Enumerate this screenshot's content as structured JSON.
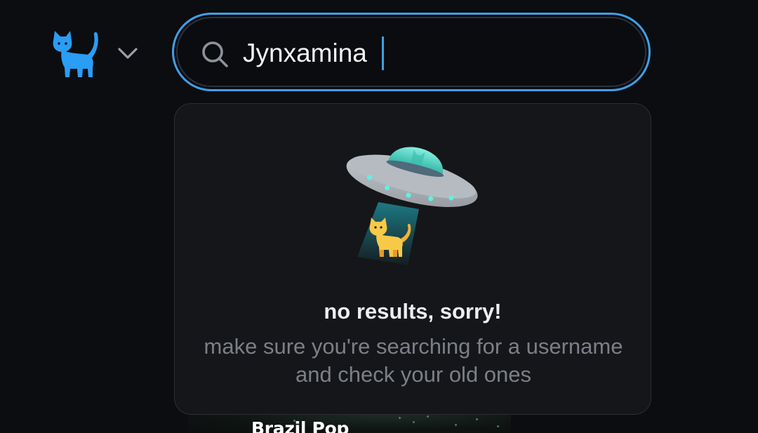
{
  "header": {
    "logo_icon": "cat-icon",
    "account_menu_icon": "chevron-down-icon"
  },
  "search": {
    "icon": "search-icon",
    "value": "Jynxamina",
    "accent_color": "#3ea0e8"
  },
  "dropdown": {
    "illustration_icon": "ufo-abducting-cat-icon",
    "title": "no results, sorry!",
    "hint": "make sure you're searching for a username and check your old ones"
  },
  "background": {
    "label": "Brazil Pop"
  },
  "colors": {
    "background": "#0c0d10",
    "panel": "#151619",
    "brand": "#2a9df4",
    "muted_text": "#7b7f87"
  }
}
